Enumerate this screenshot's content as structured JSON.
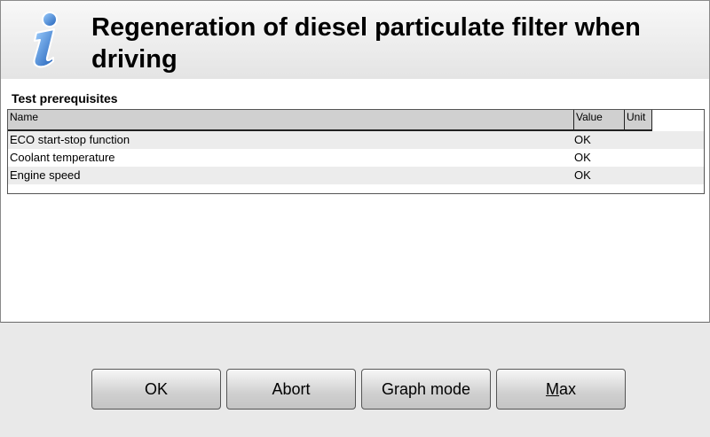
{
  "header": {
    "title": "Regeneration of diesel particulate filter when driving",
    "icon": "info-icon"
  },
  "content": {
    "section_label": "Test prerequisites",
    "table": {
      "columns": [
        "Name",
        "Value",
        "Unit"
      ],
      "rows": [
        {
          "name": "ECO start-stop function",
          "value": "OK",
          "unit": ""
        },
        {
          "name": "Coolant temperature",
          "value": "OK",
          "unit": ""
        },
        {
          "name": "Engine speed",
          "value": "OK",
          "unit": ""
        }
      ]
    }
  },
  "buttons": {
    "ok": "OK",
    "abort": "Abort",
    "graph_mode": "Graph mode",
    "max_first": "M",
    "max_rest": "ax"
  },
  "colors": {
    "icon_blue": "#2b6cc4"
  }
}
